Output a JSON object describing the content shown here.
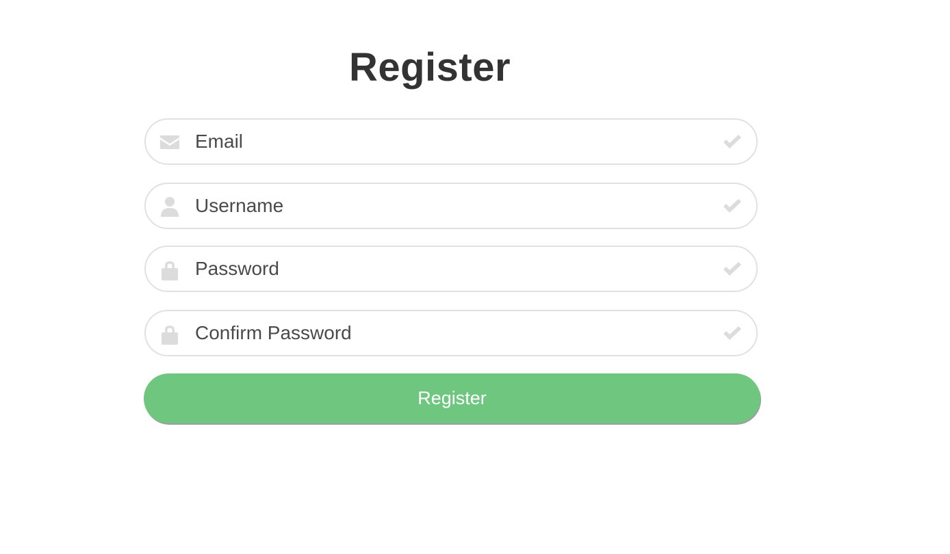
{
  "page": {
    "title": "Register"
  },
  "form": {
    "fields": [
      {
        "placeholder": "Email",
        "value": "",
        "icon": "envelope-icon",
        "status_icon": "check-icon"
      },
      {
        "placeholder": "Username",
        "value": "",
        "icon": "user-icon",
        "status_icon": "check-icon"
      },
      {
        "placeholder": "Password",
        "value": "",
        "icon": "lock-icon",
        "status_icon": "check-icon"
      },
      {
        "placeholder": "Confirm Password",
        "value": "",
        "icon": "lock-icon",
        "status_icon": "check-icon"
      }
    ],
    "submit_label": "Register"
  },
  "colors": {
    "accent": "#6fc67f",
    "icon_gray": "#dcdcdc",
    "field_border": "#e1e1e1",
    "title_text": "#333333"
  }
}
